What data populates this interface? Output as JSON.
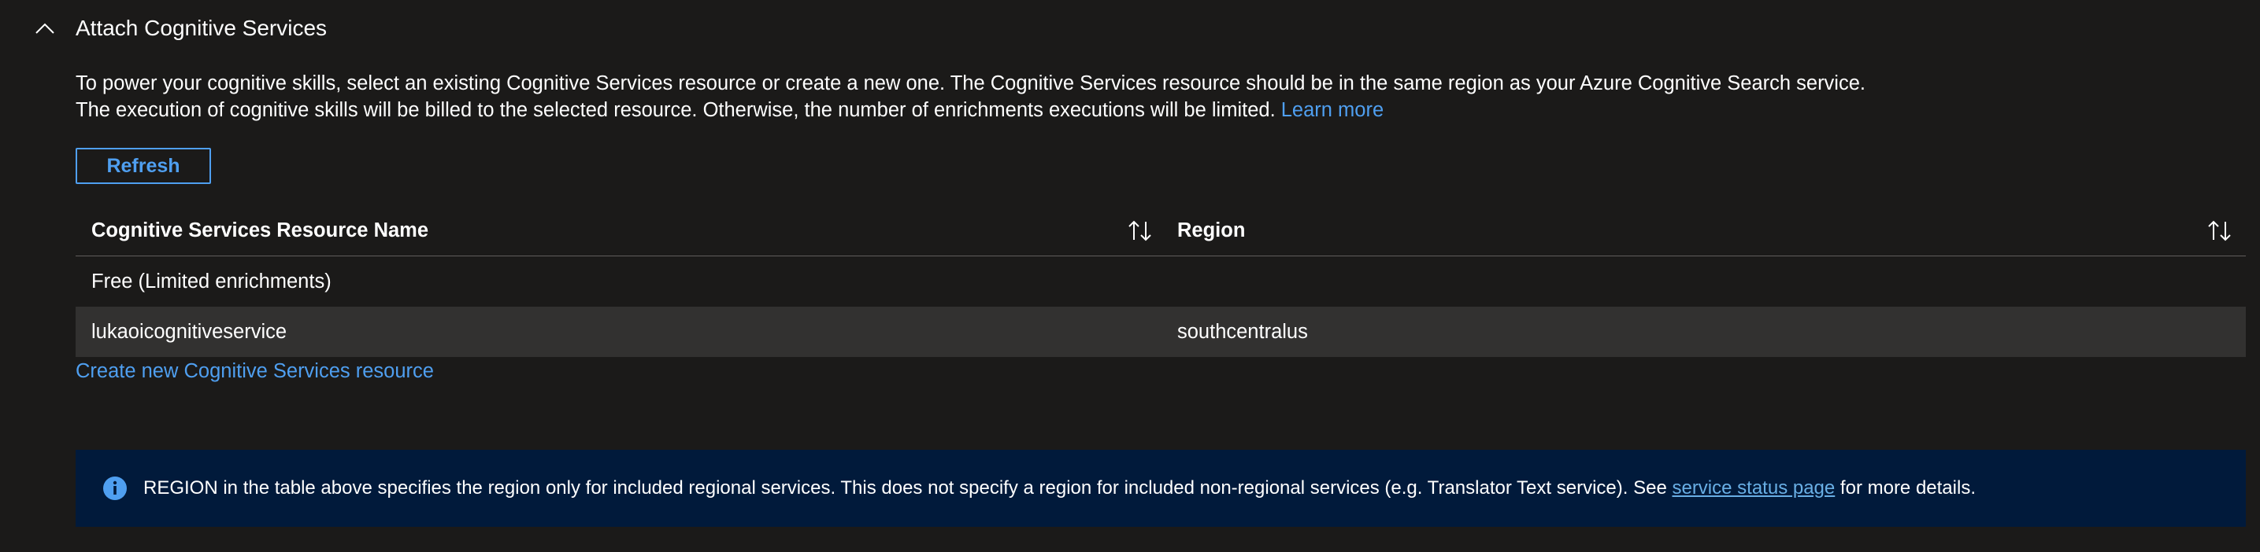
{
  "section": {
    "title": "Attach Cognitive Services"
  },
  "description": {
    "line1": "To power your cognitive skills, select an existing Cognitive Services resource or create a new one. The Cognitive Services resource should be in the same region as your Azure Cognitive Search service.",
    "line2": "The execution of cognitive skills will be billed to the selected resource. Otherwise, the number of enrichments executions will be limited.",
    "learn_more": "Learn more"
  },
  "toolbar": {
    "refresh_label": "Refresh"
  },
  "table": {
    "columns": [
      "Cognitive Services Resource Name",
      "Region"
    ],
    "rows": [
      {
        "name": "Free (Limited enrichments)",
        "region": ""
      },
      {
        "name": "lukaoicognitiveservice",
        "region": "southcentralus",
        "selected": true
      }
    ]
  },
  "create_link": "Create new Cognitive Services resource",
  "info": {
    "text_before": "REGION in the table above specifies the region only for included regional services. This does not specify a region for included non-regional services (e.g. Translator Text service). See",
    "link": "service status page",
    "text_after": "for more details."
  },
  "colors": {
    "background": "#1b1a19",
    "accent": "#4f9ff0",
    "info_background": "#011a3b",
    "selected_row": "#323130"
  },
  "icons": {
    "collapse": "chevron-up-icon",
    "sort": "sort-icon",
    "info": "info-icon"
  }
}
